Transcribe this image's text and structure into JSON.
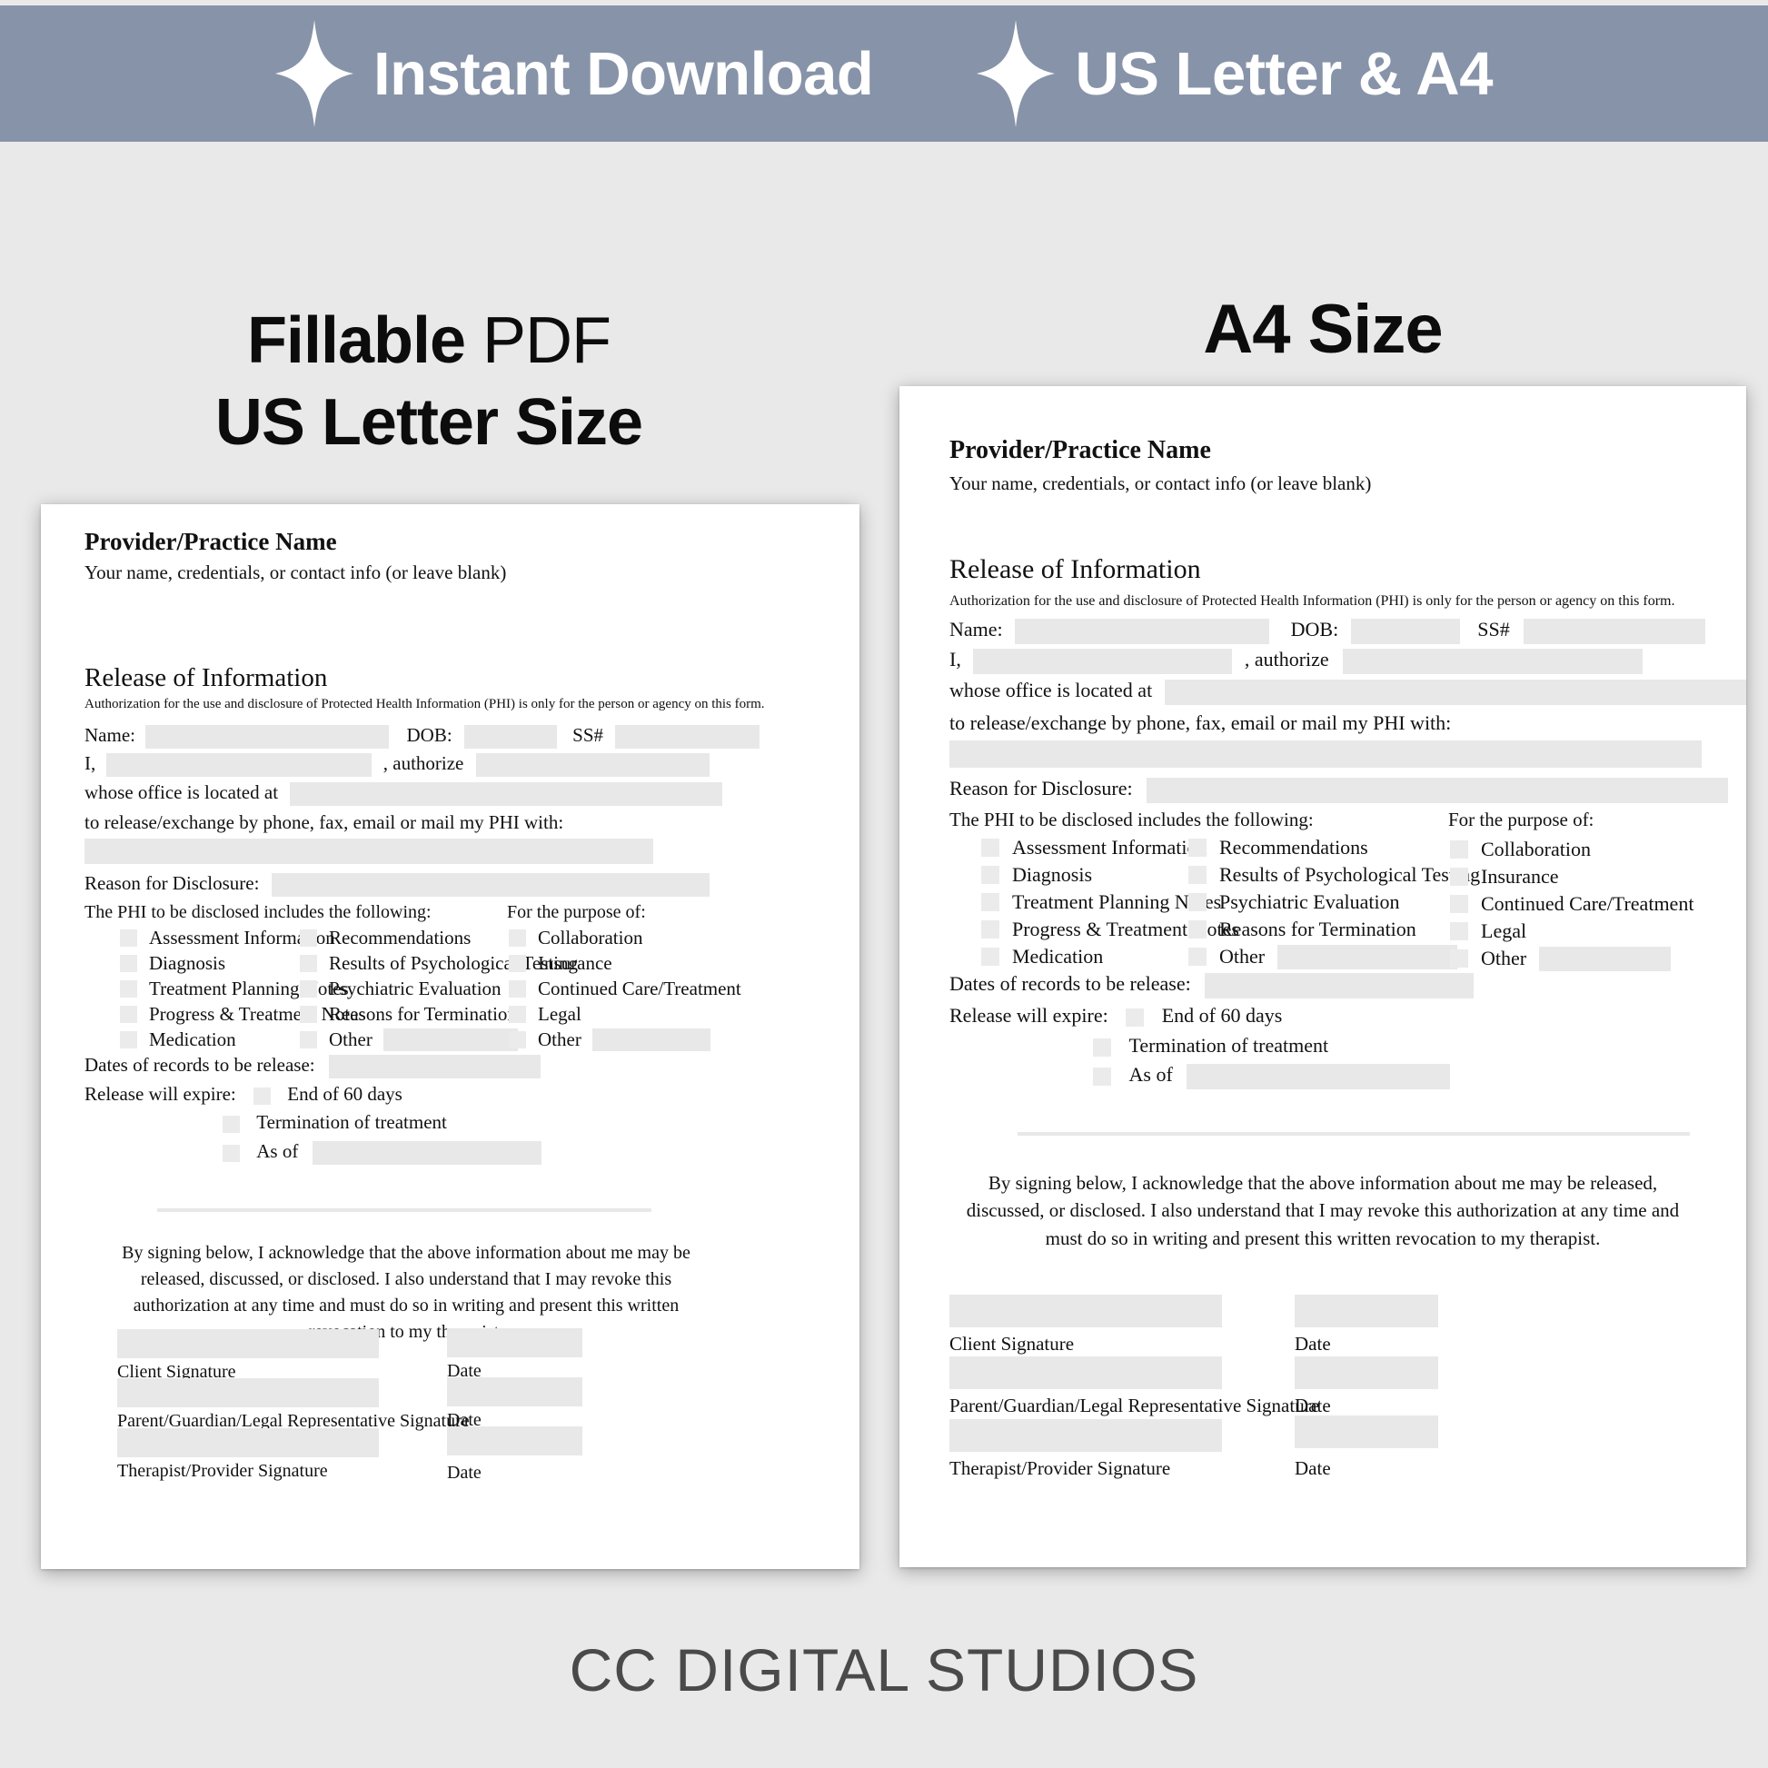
{
  "banner": {
    "items": [
      {
        "icon": "sparkle-icon",
        "label": "Instant Download"
      },
      {
        "icon": "sparkle-icon",
        "label": "US Letter & A4"
      }
    ],
    "background_color": "#8793a8",
    "text_color": "#ffffff"
  },
  "headings": {
    "left_line1_bold": "Fillable",
    "left_line1_light": "PDF",
    "left_line2": "US Letter Size",
    "right": "A4 Size"
  },
  "footer": {
    "brand": "CC DIGITAL STUDIOS"
  },
  "document": {
    "provider_name": "Provider/Practice Name",
    "provider_sub": "Your name, credentials, or contact info (or leave blank)",
    "section_title": "Release of Information",
    "section_sub": "Authorization for the use and disclosure of Protected Health Information (PHI) is only for the person or agency on this form.",
    "labels": {
      "name": "Name:",
      "dob": "DOB:",
      "ssn": "SS#",
      "i": "I,",
      "authorize": ", authorize",
      "whose_office": "whose office is located at",
      "to_release": "to release/exchange by phone, fax, email or mail my PHI with:",
      "reason": "Reason for Disclosure:",
      "phi_heading": "The PHI to be disclosed includes the following:",
      "purpose_heading": "For the purpose of:",
      "dates_of_records": "Dates of records to be release:",
      "release_will_expire": "Release will expire:"
    },
    "phi_col1": [
      "Assessment Information",
      "Diagnosis",
      "Treatment Planning Notes",
      "Progress & Treatment Notes",
      "Medication"
    ],
    "phi_col2": [
      "Recommendations",
      "Results of Psychological Testing",
      "Psychiatric Evaluation",
      "Reasons for Termination",
      "Other"
    ],
    "purpose_col": [
      "Collaboration",
      "Insurance",
      "Continued Care/Treatment",
      "Legal",
      "Other"
    ],
    "expire_options": [
      "End of 60 days",
      "Termination of treatment",
      "As of"
    ],
    "attestation": "By signing below, I acknowledge that the above information about me may be released, discussed, or disclosed.  I also understand that I may revoke this authorization at any time and must do so in writing and present this written revocation to my therapist.",
    "signatures": [
      {
        "signature_label": "Client Signature",
        "date_label": "Date"
      },
      {
        "signature_label": "Parent/Guardian/Legal Representative Signature",
        "date_label": "Date"
      },
      {
        "signature_label": "Therapist/Provider Signature",
        "date_label": "Date"
      }
    ]
  },
  "colors": {
    "page_background": "#e9e9e9",
    "banner": "#8793a8",
    "field_fill": "#e8e8e8",
    "checkbox_fill": "#ebebeb",
    "brand_text": "#4a4a4a"
  }
}
